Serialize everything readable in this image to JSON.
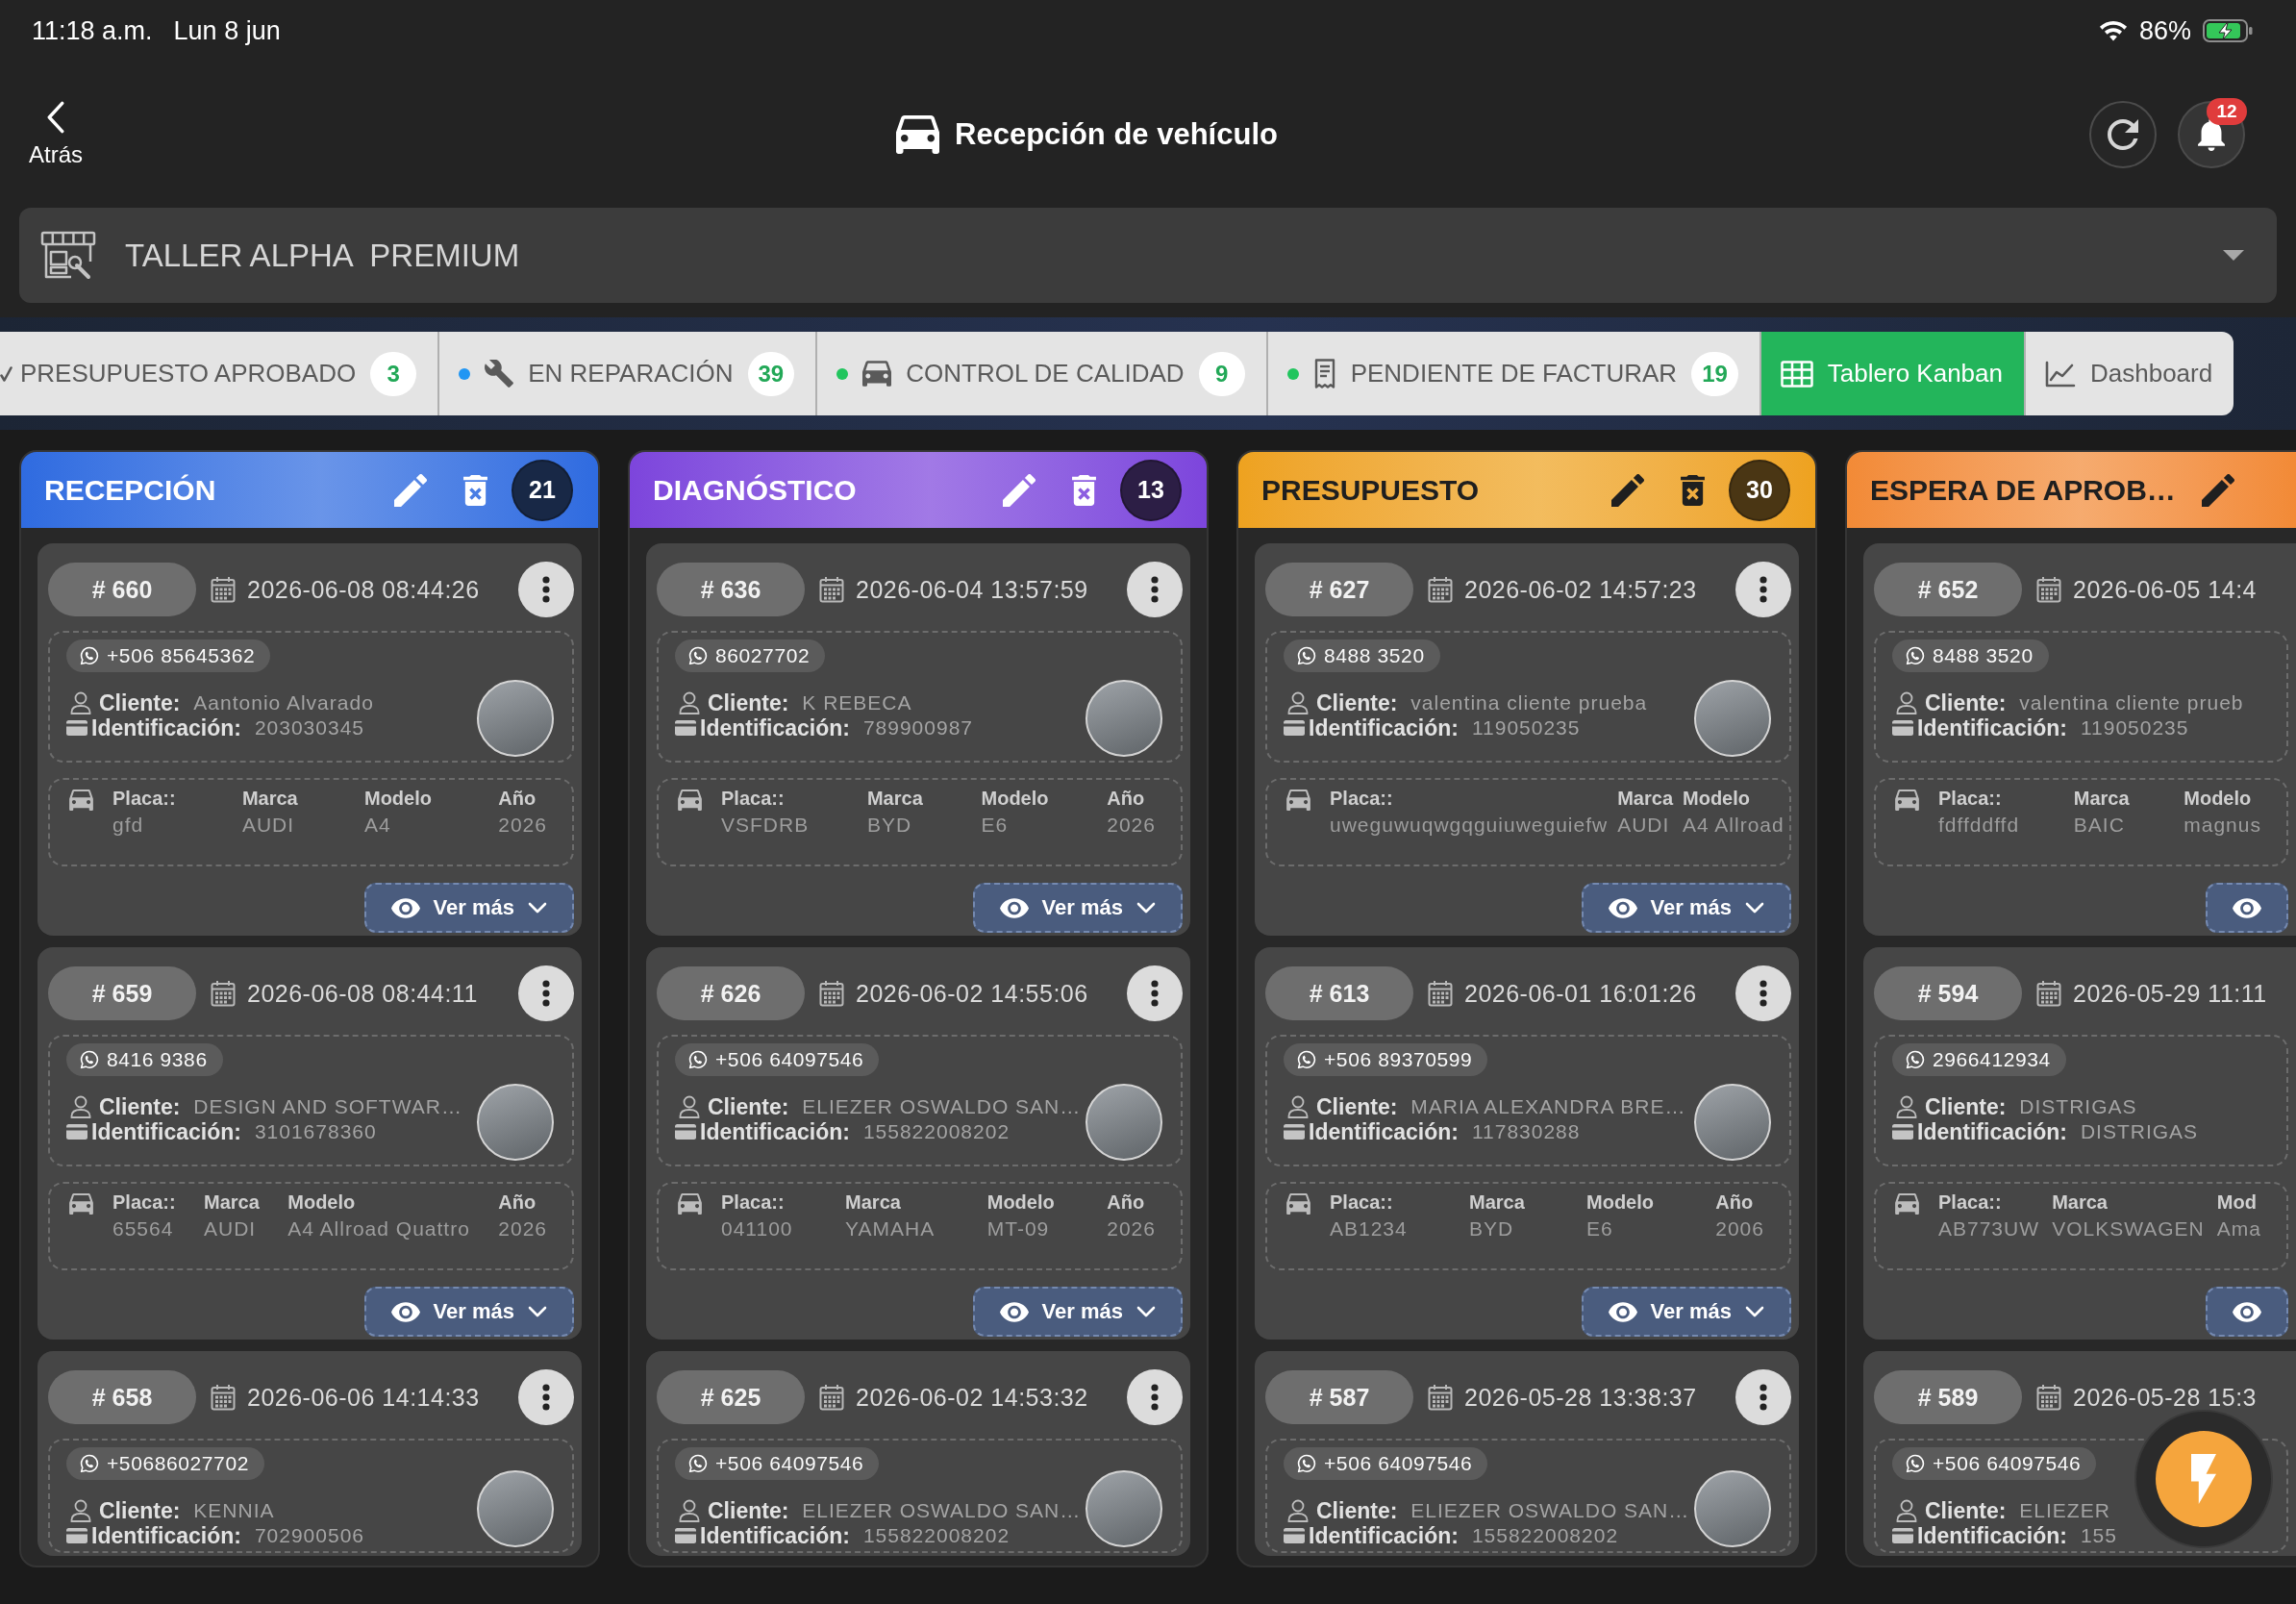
{
  "status_bar": {
    "time": "11:18 a.m.",
    "date": "Lun 8 jun",
    "battery": "86%"
  },
  "header": {
    "back_label": "Atrás",
    "title": "Recepción de vehículo",
    "notifications": "12"
  },
  "workshop": {
    "value": "TALLER ALPHA  PREMIUM"
  },
  "tabs": [
    {
      "label": "PRESUPUESTO APROBADO",
      "count": "3",
      "selected": false
    },
    {
      "label": "EN REPARACIÓN",
      "count": "39",
      "color": "#2196f3",
      "selected": false
    },
    {
      "label": "CONTROL DE CALIDAD",
      "count": "9",
      "color": "#22c55e",
      "selected": false
    },
    {
      "label": "PENDIENTE DE FACTURAR",
      "count": "19",
      "color": "#22c55e",
      "selected": false
    },
    {
      "label": "Tablero Kanban",
      "selected": true
    },
    {
      "label": "Dashboard",
      "selected": false
    }
  ],
  "columns": [
    {
      "title": "RECEPCIÓN",
      "count": "21",
      "color": "#2f6be0",
      "edit_button": true,
      "delete_button": true,
      "cards": [
        {
          "number": "# 660",
          "date": "2026-06-08 08:44:26",
          "menu_button": true,
          "phone": "+506 85645362",
          "client": {
            "label": "Cliente:",
            "value": "Aantonio Alvarado"
          },
          "identification": {
            "label": "Identificación:",
            "value": "203030345"
          },
          "vehicle_photo": true,
          "vehicle": [
            {
              "label": "Placa::",
              "value": "gfd"
            },
            {
              "label": "Marca",
              "value": "AUDI"
            },
            {
              "label": "Modelo",
              "value": "A4"
            },
            {
              "label": "Año",
              "value": "2026"
            }
          ],
          "more_button": true,
          "more_label": "Ver más"
        },
        {
          "number": "# 659",
          "date": "2026-06-08 08:44:11",
          "menu_button": true,
          "phone": "8416 9386",
          "client": {
            "label": "Cliente:",
            "value": "DESIGN AND SOFTWAR…"
          },
          "identification": {
            "label": "Identificación:",
            "value": "3101678360"
          },
          "vehicle_photo": true,
          "vehicle": [
            {
              "label": "Placa::",
              "value": "65564"
            },
            {
              "label": "Marca",
              "value": "AUDI"
            },
            {
              "label": "Modelo",
              "value": "A4 Allroad Quattro"
            },
            {
              "label": "Año",
              "value": "2026"
            }
          ],
          "more_button": true,
          "more_label": "Ver más"
        },
        {
          "number": "# 658",
          "date": "2026-06-06 14:14:33",
          "menu_button": true,
          "phone": "+50686027702",
          "client": {
            "label": "Cliente:",
            "value": "KENNIA"
          },
          "identification": {
            "label": "Identificación:",
            "value": "702900506"
          },
          "vehicle_photo": true
        }
      ]
    },
    {
      "title": "DIAGNÓSTICO",
      "count": "13",
      "color": "#7d45dc",
      "edit_button": true,
      "delete_button": true,
      "cards": [
        {
          "number": "# 636",
          "date": "2026-06-04 13:57:59",
          "menu_button": true,
          "phone": "86027702",
          "client": {
            "label": "Cliente:",
            "value": "K REBECA"
          },
          "identification": {
            "label": "Identificación:",
            "value": "789900987"
          },
          "vehicle_photo": true,
          "vehicle": [
            {
              "label": "Placa::",
              "value": "VSFDRB"
            },
            {
              "label": "Marca",
              "value": "BYD"
            },
            {
              "label": "Modelo",
              "value": "E6"
            },
            {
              "label": "Año",
              "value": "2026"
            }
          ],
          "more_button": true,
          "more_label": "Ver más"
        },
        {
          "number": "# 626",
          "date": "2026-06-02 14:55:06",
          "menu_button": true,
          "phone": "+506 64097546",
          "client": {
            "label": "Cliente:",
            "value": "ELIEZER OSWALDO SAN…"
          },
          "identification": {
            "label": "Identificación:",
            "value": "155822008202"
          },
          "vehicle_photo": true,
          "vehicle": [
            {
              "label": "Placa::",
              "value": "041100"
            },
            {
              "label": "Marca",
              "value": "YAMAHA"
            },
            {
              "label": "Modelo",
              "value": "MT-09"
            },
            {
              "label": "Año",
              "value": "2026"
            }
          ],
          "more_button": true,
          "more_label": "Ver más"
        },
        {
          "number": "# 625",
          "date": "2026-06-02 14:53:32",
          "menu_button": true,
          "phone": "+506 64097546",
          "client": {
            "label": "Cliente:",
            "value": "ELIEZER OSWALDO SAN…"
          },
          "identification": {
            "label": "Identificación:",
            "value": "155822008202"
          },
          "vehicle_photo": true
        }
      ]
    },
    {
      "title": "PRESUPUESTO",
      "count": "30",
      "color": "#eea21f",
      "edit_button": true,
      "delete_button": true,
      "cards": [
        {
          "number": "# 627",
          "date": "2026-06-02 14:57:23",
          "menu_button": true,
          "phone": "8488 3520",
          "client": {
            "label": "Cliente:",
            "value": "valentina cliente prueba"
          },
          "identification": {
            "label": "Identificación:",
            "value": "119050235"
          },
          "vehicle_photo": true,
          "vehicle": [
            {
              "label": "Placa::",
              "value": "uweguwuqwgqguiuweguiefw"
            },
            {
              "label": "Marca",
              "value": "AUDI"
            },
            {
              "label": "Modelo",
              "value": "A4 Allroad"
            }
          ],
          "more_button": true,
          "more_label": "Ver más"
        },
        {
          "number": "# 613",
          "date": "2026-06-01 16:01:26",
          "menu_button": true,
          "phone": "+506 89370599",
          "client": {
            "label": "Cliente:",
            "value": "MARIA ALEXANDRA BRE…"
          },
          "identification": {
            "label": "Identificación:",
            "value": "117830288"
          },
          "vehicle_photo": true,
          "vehicle": [
            {
              "label": "Placa::",
              "value": "AB1234"
            },
            {
              "label": "Marca",
              "value": "BYD"
            },
            {
              "label": "Modelo",
              "value": "E6"
            },
            {
              "label": "Año",
              "value": "2006"
            }
          ],
          "more_button": true,
          "more_label": "Ver más"
        },
        {
          "number": "# 587",
          "date": "2026-05-28 13:38:37",
          "menu_button": true,
          "phone": "+506 64097546",
          "client": {
            "label": "Cliente:",
            "value": "ELIEZER OSWALDO SAN…"
          },
          "identification": {
            "label": "Identificación:",
            "value": "155822008202"
          },
          "vehicle_photo": true
        }
      ]
    },
    {
      "title": "ESPERA DE APROB…",
      "color": "#f28a36",
      "edit_button": true,
      "delete_button": false,
      "cards": [
        {
          "number": "# 652",
          "date": "2026-06-05 14:4",
          "menu_button": false,
          "phone": "8488 3520",
          "client": {
            "label": "Cliente:",
            "value": "valentina cliente prueb"
          },
          "identification": {
            "label": "Identificación:",
            "value": "119050235"
          },
          "vehicle_photo": false,
          "vehicle": [
            {
              "label": "Placa::",
              "value": "fdffddffd"
            },
            {
              "label": "Marca",
              "value": "BAIC"
            },
            {
              "label": "Modelo",
              "value": "magnus"
            }
          ],
          "more_button": true
        },
        {
          "number": "# 594",
          "date": "2026-05-29 11:11",
          "menu_button": false,
          "phone": "2966412934",
          "client": {
            "label": "Cliente:",
            "value": "DISTRIGAS"
          },
          "identification": {
            "label": "Identificación:",
            "value": "DISTRIGAS"
          },
          "vehicle_photo": false,
          "vehicle": [
            {
              "label": "Placa::",
              "value": "AB773UW"
            },
            {
              "label": "Marca",
              "value": "VOLKSWAGEN"
            },
            {
              "label": "Mod",
              "value": "Ama"
            }
          ],
          "more_button": true
        },
        {
          "number": "# 589",
          "date": "2026-05-28 15:3",
          "menu_button": false,
          "phone": "+506 64097546",
          "client": {
            "label": "Cliente:",
            "value": "ELIEZER"
          },
          "identification": {
            "label": "Identificación:",
            "value": "155"
          },
          "vehicle_photo": false
        }
      ]
    }
  ]
}
